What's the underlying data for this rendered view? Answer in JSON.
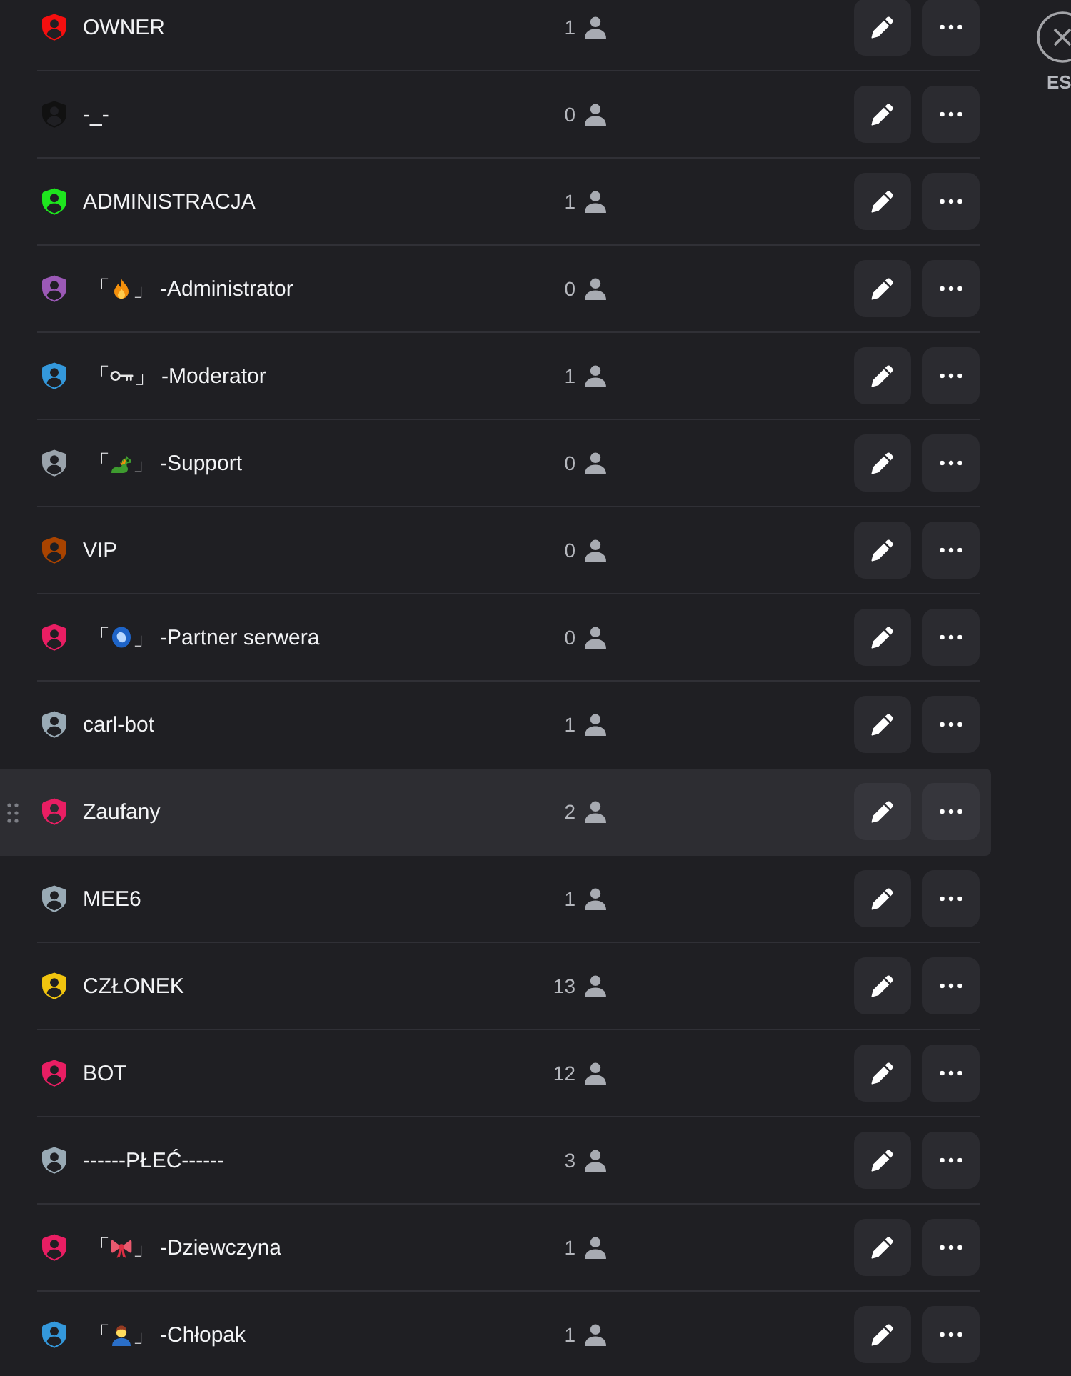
{
  "roles": [
    {
      "name": "OWNER",
      "color": "#f50f0f",
      "members": "1",
      "hovered": false
    },
    {
      "name": "-_-",
      "color": "#111111",
      "members": "0",
      "hovered": false
    },
    {
      "name": "ADMINISTRACJA",
      "color": "#1ee51e",
      "members": "1",
      "hovered": false
    },
    {
      "kind": "fire",
      "tag_open": "「",
      "tag_close": "」",
      "name": "-Administrator",
      "color": "#9b59b6",
      "members": "0",
      "hovered": false
    },
    {
      "kind": "key",
      "tag_open": "「",
      "tag_close": "」",
      "name": "-Moderator",
      "color": "#3498db",
      "members": "1",
      "hovered": false
    },
    {
      "kind": "dragon",
      "tag_open": "「",
      "tag_close": "」",
      "name": "-Support",
      "color": "#9aa3ab",
      "members": "0",
      "hovered": false
    },
    {
      "name": "VIP",
      "color": "#a84300",
      "members": "0",
      "hovered": false
    },
    {
      "kind": "orb",
      "tag_open": "「",
      "tag_close": "」",
      "name": "-Partner serwera",
      "color": "#e91e63",
      "members": "0",
      "hovered": false
    },
    {
      "name": "carl-bot",
      "color": "#99aab5",
      "members": "1",
      "hovered": false
    },
    {
      "name": "Zaufany",
      "color": "#e91e63",
      "members": "2",
      "hovered": true
    },
    {
      "name": "MEE6",
      "color": "#99aab5",
      "members": "1",
      "hovered": false
    },
    {
      "name": "CZŁONEK",
      "color": "#f1c40f",
      "members": "13",
      "hovered": false
    },
    {
      "name": "BOT",
      "color": "#e91e63",
      "members": "12",
      "hovered": false
    },
    {
      "name": "------PŁEĆ------",
      "color": "#99aab5",
      "members": "3",
      "hovered": false
    },
    {
      "kind": "bow",
      "tag_open": "「",
      "tag_close": "」",
      "name": "-Dziewczyna",
      "color": "#e91e63",
      "members": "1",
      "hovered": false
    },
    {
      "kind": "person",
      "tag_open": "「",
      "tag_close": "」",
      "name": "-Chłopak",
      "color": "#3498db",
      "members": "1",
      "hovered": false
    }
  ],
  "close_button": {
    "label": "ES"
  }
}
